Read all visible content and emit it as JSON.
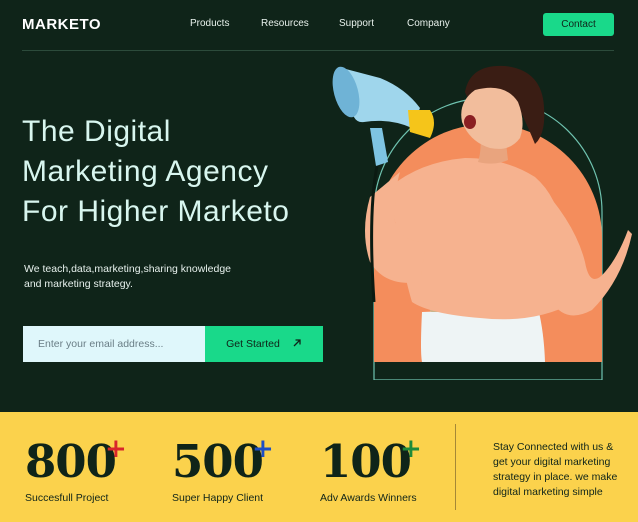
{
  "brand": {
    "logo": "MARKETO"
  },
  "nav": {
    "items": [
      "Products",
      "Resources",
      "Support",
      "Company"
    ],
    "contact_label": "Contact"
  },
  "hero": {
    "headline_lines": [
      "The Digital",
      "Marketing Agency",
      "For Higher Marketo"
    ],
    "subtitle_lines": [
      "We teach,data,marketing,sharing knowledge",
      "and marketing strategy."
    ],
    "email_placeholder": "Enter your email address...",
    "cta_label": "Get Started",
    "cta_icon": "arrow-up-right"
  },
  "stats": [
    {
      "value": "800",
      "label": "Succesfull Project",
      "plus_color": "#d8262b"
    },
    {
      "value": "500",
      "label": "Super Happy Client",
      "plus_color": "#1e4fc4"
    },
    {
      "value": "100",
      "label": "Adv Awards Winners",
      "plus_color": "#1f8a3a"
    }
  ],
  "newsletter": {
    "lines": [
      "Stay Connected with us &",
      "get your digital marketing",
      "strategy in place. we make",
      "digital marketing simple"
    ]
  },
  "colors": {
    "background": "#0f2419",
    "accent_green": "#19d98a",
    "stats_yellow": "#fbd24c",
    "headline": "#d8f6ef",
    "arch_orange": "#f48d5c"
  }
}
